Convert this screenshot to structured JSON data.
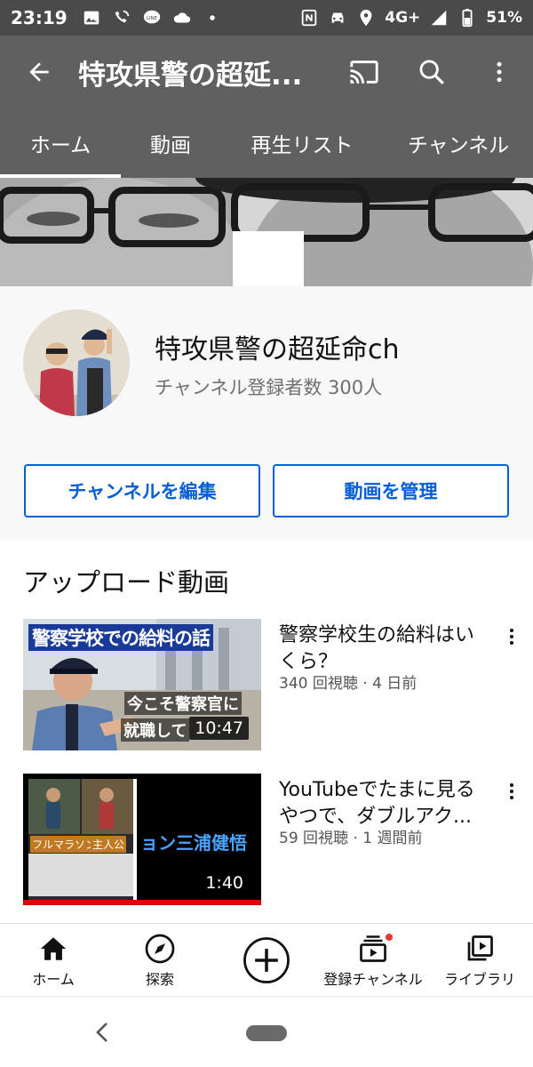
{
  "status_bar": {
    "time": "23:19",
    "network": "4G+",
    "battery": "51%",
    "left_icons": [
      "gallery-icon",
      "wifi-calling-icon",
      "line-icon",
      "cloud-icon",
      "dot-icon"
    ],
    "right_icons": [
      "nfc-icon",
      "car-icon",
      "location-icon",
      "signal-icon",
      "battery-icon"
    ]
  },
  "app_bar": {
    "title": "特攻県警の超延...",
    "icons": [
      "back-arrow-icon",
      "cast-icon",
      "search-icon",
      "more-vert-icon"
    ]
  },
  "tabs": [
    {
      "label": "ホーム",
      "active": true
    },
    {
      "label": "動画",
      "active": false
    },
    {
      "label": "再生リスト",
      "active": false
    },
    {
      "label": "チャンネル",
      "active": false
    }
  ],
  "channel": {
    "name": "特攻県警の超延命ch",
    "subscribers": "チャンネル登録者数 300人",
    "edit_button": "チャンネルを編集",
    "manage_button": "動画を管理"
  },
  "uploads": {
    "section_title": "アップロード動画",
    "videos": [
      {
        "title": "警察学校生の給料はいくら？",
        "meta": "340 回視聴 · 4 日前",
        "duration": "10:47",
        "thumb_caption_top": "警察学校での給料の話",
        "thumb_caption_bottom_1": "今こそ警察官に",
        "thumb_caption_bottom_2": "就職して"
      },
      {
        "title": "YouTubeでたまに見るやつで、ダブルアク...",
        "meta": "59 回視聴 · 1 週間前",
        "duration": "1:40",
        "thumb_label_1": "フルマラソン",
        "thumb_label_2": "主人公",
        "thumb_caption": "ョン三浦健悟"
      }
    ]
  },
  "bottom_nav": [
    {
      "label": "ホーム",
      "icon": "home-icon",
      "active": true
    },
    {
      "label": "探索",
      "icon": "explore-icon",
      "active": false
    },
    {
      "label": "",
      "icon": "add-circle-icon",
      "active": false
    },
    {
      "label": "登録チャンネル",
      "icon": "subscriptions-icon",
      "active": false,
      "badge": true
    },
    {
      "label": "ライブラリ",
      "icon": "library-icon",
      "active": false
    }
  ],
  "colors": {
    "app_bar_bg": "#606060",
    "accent_blue": "#065fd4",
    "badge_red": "#e53935"
  }
}
